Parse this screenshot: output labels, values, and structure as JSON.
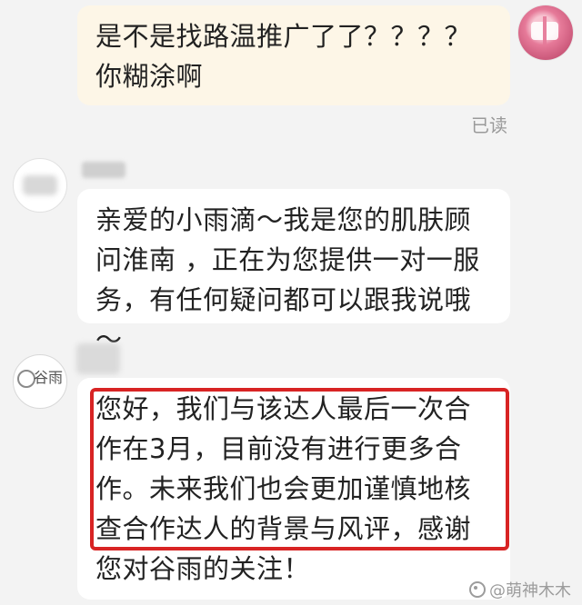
{
  "messages": {
    "mine": {
      "text": "是不是找路温推广了了？？？？你糊涂啊",
      "status": "已读"
    },
    "consultant": {
      "text": "亲爱的小雨滴～我是您的肌肤顾问淮南 ，正在为您提供一对一服务，有任何疑问都可以跟我说哦～"
    },
    "official": {
      "text": "您好，我们与该达人最后一次合作在3月，目前没有进行更多合作。未来我们也会更加谨慎地核查合作达人的背景与风评，感谢您对谷雨的关注！"
    }
  },
  "avatars": {
    "official_logo_text": "谷雨"
  },
  "watermark": {
    "text": "@萌神木木"
  },
  "colors": {
    "background": "#f3f3f3",
    "bubble_mine": "#fdf6e7",
    "bubble_other": "#ffffff",
    "highlight": "#d82424",
    "status_text": "#9a9a9a"
  }
}
